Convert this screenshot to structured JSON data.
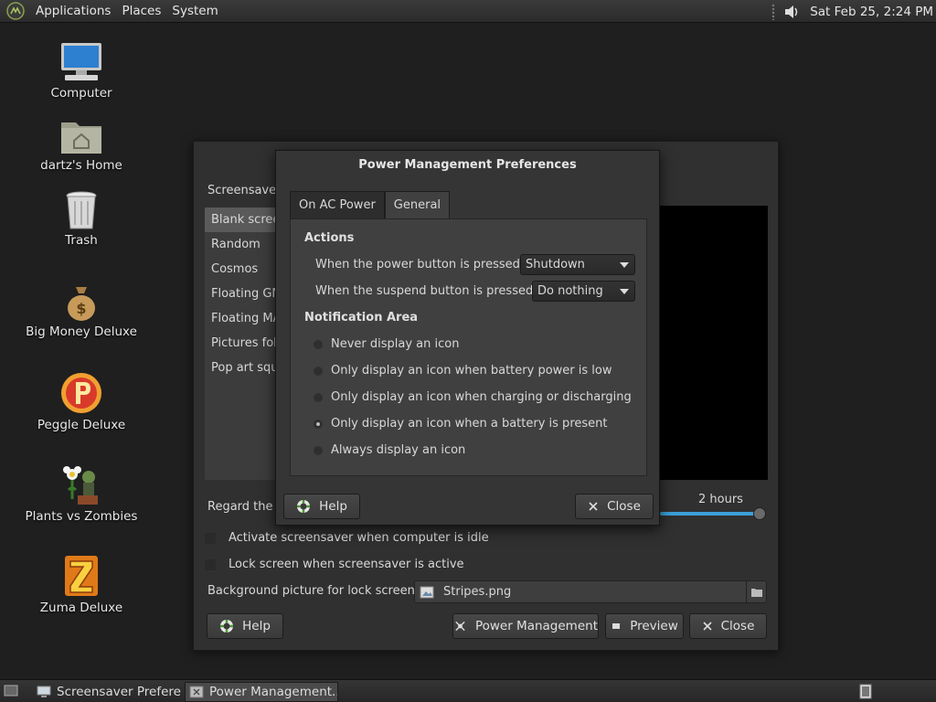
{
  "top_panel": {
    "menus": [
      "Applications",
      "Places",
      "System"
    ],
    "clock": "Sat Feb 25,  2:24 PM"
  },
  "desktop": {
    "icons": [
      {
        "label": "Computer",
        "icon": "computer-icon"
      },
      {
        "label": "dartz's Home",
        "icon": "home-folder-icon"
      },
      {
        "label": "Trash",
        "icon": "trash-icon"
      },
      {
        "label": "Big Money Deluxe",
        "icon": "money-bag-icon"
      },
      {
        "label": "Peggle Deluxe",
        "icon": "peggle-icon"
      },
      {
        "label": "Plants vs Zombies",
        "icon": "plants-vs-zombies-icon"
      },
      {
        "label": "Zuma Deluxe",
        "icon": "zuma-icon"
      }
    ]
  },
  "screensaver_window": {
    "list_heading": "Screensaver",
    "themes": [
      "Blank screen",
      "Random",
      "Cosmos",
      "Floating GNOME",
      "Floating MATE",
      "Pictures folder",
      "Pop art squares"
    ],
    "selected_theme": "Blank screen",
    "regard_label": "Regard the computer as idle after:",
    "idle_value": "2 hours",
    "activate_label": "Activate screensaver when computer is idle",
    "lock_label": "Lock screen when screensaver is active",
    "background_label": "Background picture for lock screen:",
    "background_file": "Stripes.png",
    "buttons": {
      "help": "Help",
      "power_management": "Power Management",
      "preview": "Preview",
      "close": "Close"
    }
  },
  "power_dialog": {
    "title": "Power Management Preferences",
    "tabs": [
      "On AC Power",
      "General"
    ],
    "active_tab": "General",
    "actions_heading": "Actions",
    "power_button_label": "When the power button is pressed:",
    "power_button_value": "Shutdown",
    "suspend_button_label": "When the suspend button is pressed:",
    "suspend_button_value": "Do nothing",
    "notification_heading": "Notification Area",
    "notification_options": [
      "Never display an icon",
      "Only display an icon when battery power is low",
      "Only display an icon when charging or discharging",
      "Only display an icon when a battery is present",
      "Always display an icon"
    ],
    "selected_notification": "Only display an icon when a battery is present",
    "buttons": {
      "help": "Help",
      "close": "Close"
    }
  },
  "taskbar": {
    "tasks": [
      {
        "label": "Screensaver Prefere...",
        "active": false
      },
      {
        "label": "Power Management...",
        "active": true
      }
    ]
  },
  "colors": {
    "accent": "#3aa0d8",
    "desktop_bg": "#1f1f1f"
  }
}
